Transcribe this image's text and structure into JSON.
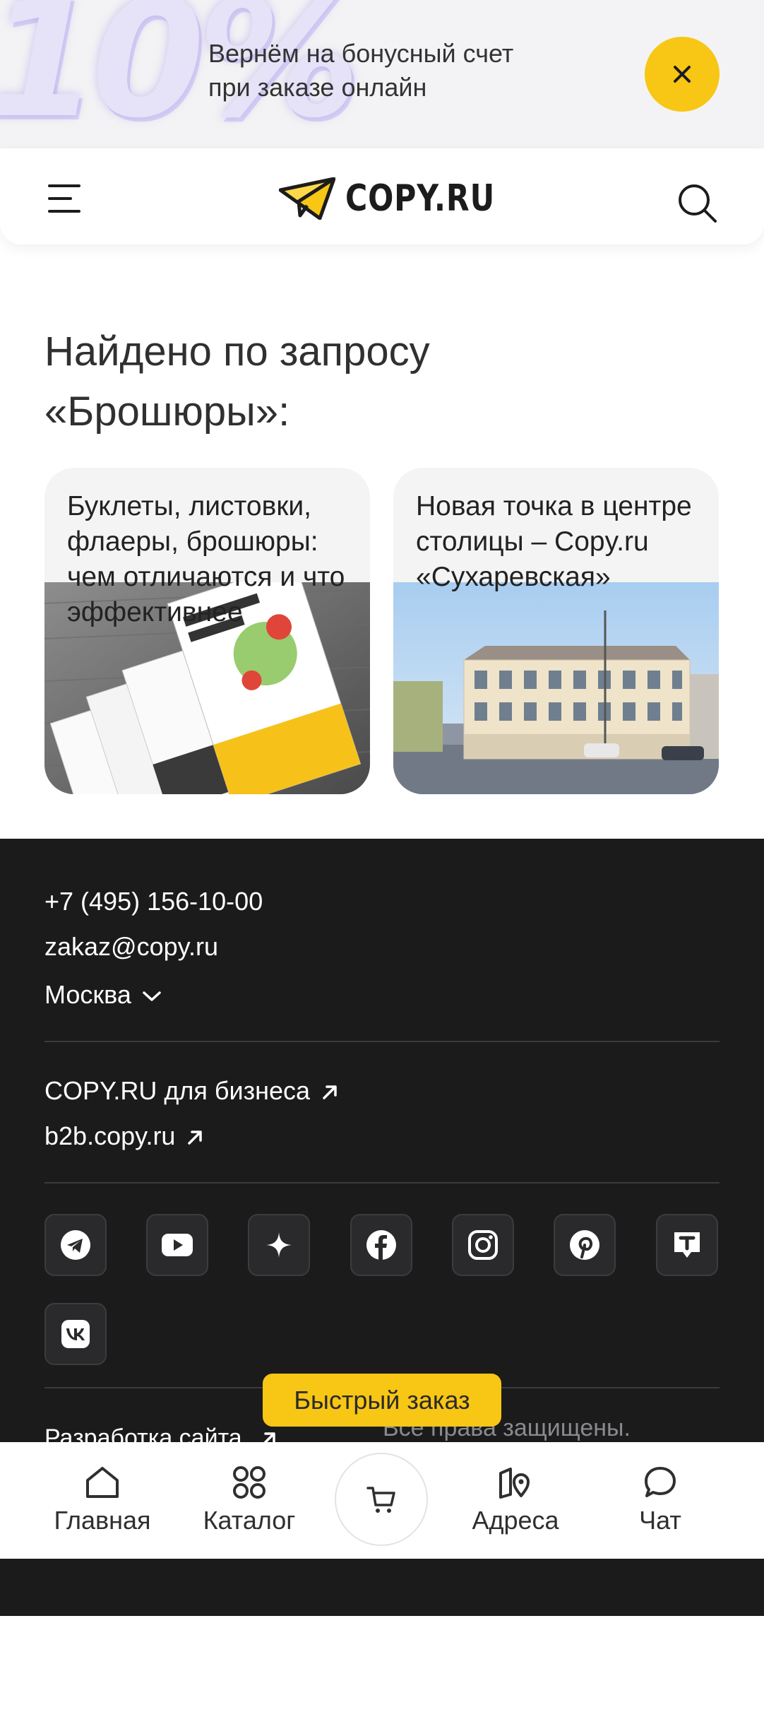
{
  "promo": {
    "deco": "10%",
    "line1": "Вернём на бонусный счет",
    "line2": "при заказе онлайн",
    "close_icon": "close-icon",
    "accent": "#f8c614"
  },
  "header": {
    "logo_text": "COPY.RU",
    "menu_icon": "menu-icon",
    "search_icon": "search-icon"
  },
  "results": {
    "title": "Найдено по запросу «Брошюры»:",
    "cards": [
      {
        "title": "Буклеты, листовки, флаеры, брошюры: чем отличаются и что эффективнее"
      },
      {
        "title": "Новая точка в центре столицы – Copy.ru «Сухаревская»"
      }
    ]
  },
  "footer": {
    "phone": "+7 (495) 156-10-00",
    "email": "zakaz@copy.ru",
    "city": "Москва",
    "business_link": "COPY.RU для бизнеса",
    "b2b_link": "b2b.copy.ru",
    "socials": [
      "telegram-icon",
      "youtube-icon",
      "sparkle-icon",
      "facebook-icon",
      "instagram-icon",
      "pinterest-icon",
      "tenchat-icon",
      "vk-icon"
    ],
    "dev_link": "Разработка сайта",
    "rights": "Все права защищены.",
    "background": "#1b1b1c"
  },
  "quick_order": "Быстрый заказ",
  "bottom_nav": {
    "home": "Главная",
    "catalog": "Каталог",
    "cart_icon": "cart-icon",
    "addresses": "Адреса",
    "chat": "Чат"
  }
}
